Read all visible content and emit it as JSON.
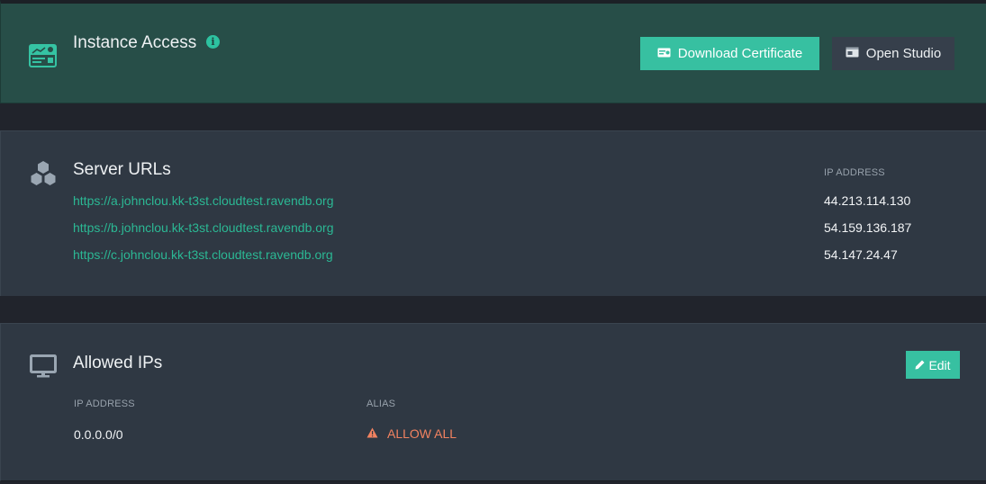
{
  "access": {
    "title": "Instance Access",
    "info_icon": "info-icon",
    "info_glyph": "i",
    "download_label": "Download Certificate",
    "studio_label": "Open Studio"
  },
  "server_urls": {
    "title": "Server URLs",
    "ip_header": "IP ADDRESS",
    "rows": [
      {
        "url": "https://a.johnclou.kk-t3st.cloudtest.ravendb.org",
        "ip": "44.213.114.130"
      },
      {
        "url": "https://b.johnclou.kk-t3st.cloudtest.ravendb.org",
        "ip": "54.159.136.187"
      },
      {
        "url": "https://c.johnclou.kk-t3st.cloudtest.ravendb.org",
        "ip": "54.147.24.47"
      }
    ]
  },
  "allowed_ips": {
    "title": "Allowed IPs",
    "edit_label": "Edit",
    "columns": [
      "IP ADDRESS",
      "ALIAS"
    ],
    "rows": [
      {
        "ip": "0.0.0.0/0",
        "alias": "ALLOW ALL",
        "warning": true
      }
    ]
  },
  "colors": {
    "accent": "#37c0a1",
    "link": "#2bb894",
    "warning": "#f28260",
    "access_panel": "#274e48",
    "panel": "#2f3843",
    "background": "#21242c"
  }
}
